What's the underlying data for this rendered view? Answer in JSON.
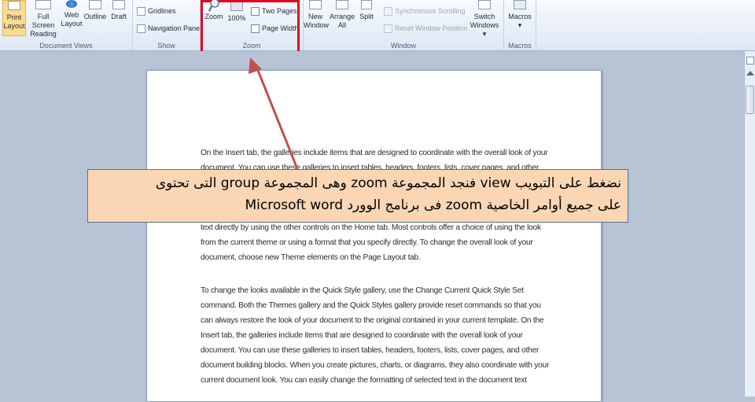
{
  "ribbon": {
    "document_views": {
      "label": "Document Views",
      "buttons": [
        {
          "line1": "Print",
          "line2": "Layout"
        },
        {
          "line1": "Full Screen",
          "line2": "Reading"
        },
        {
          "line1": "Web",
          "line2": "Layout"
        },
        {
          "line1": "Outline",
          "line2": ""
        },
        {
          "line1": "Draft",
          "line2": ""
        }
      ]
    },
    "show": {
      "label": "Show",
      "gridlines": "Gridlines",
      "navigation_pane": "Navigation Pane"
    },
    "zoom": {
      "label": "Zoom",
      "zoom_button": "Zoom",
      "hundred_percent": "100%",
      "two_pages": "Two Pages",
      "page_width": "Page Width"
    },
    "window": {
      "label": "Window",
      "new_window": {
        "line1": "New",
        "line2": "Window"
      },
      "arrange_all": {
        "line1": "Arrange",
        "line2": "All"
      },
      "split": "Split",
      "synchronous_scrolling": "Synchronous Scrolling",
      "reset_window_position": "Reset Window Position",
      "switch_windows": {
        "line1": "Switch",
        "line2": "Windows ▾"
      }
    },
    "macros": {
      "label": "Macros",
      "macros_button": {
        "line1": "Macros",
        "line2": "▾"
      }
    }
  },
  "document": {
    "paragraphs": [
      "On the Insert tab, the galleries include items that are designed to coordinate with the overall look of your document. You can use these galleries to insert tables, headers, footers, lists, cover pages, and other document building blocks. When you create pictures, charts, or diagrams, they also coordinate with your current document look. You can easily change the formatting of selected text in the document text by choosing a look for the selected text from the Quick Styles gallery on the Home tab. You can also format text directly by using the other controls on the Home tab. Most controls offer a choice of using the look from the current theme or using a format that you specify directly. To change the overall look of your document, choose new Theme elements on the Page Layout tab.",
      "To change the looks available in the Quick Style gallery, use the Change Current Quick Style Set command. Both the Themes gallery and the Quick Styles gallery provide reset commands so that you can always restore the look of your document to the original contained in your current template. On the Insert tab, the galleries include items that are designed to coordinate with the overall look of your document. You can use these galleries to insert tables, headers, footers, lists, cover pages, and other document building blocks. When you create pictures, charts, or diagrams, they also coordinate with your current document look. You can easily change the formatting of selected text in the document text"
    ]
  },
  "callout": {
    "line1": "نضغط على التبويب view فنجد المجموعة zoom وهى المجموعة group التى تحتوى",
    "line2": "على جميع أوامر الخاصية zoom فى برنامج الوورد Microsoft word"
  },
  "colors": {
    "highlight_box": "#e3061c",
    "callout_fill": "#fbd6b4",
    "arrow": "#c0504d"
  }
}
